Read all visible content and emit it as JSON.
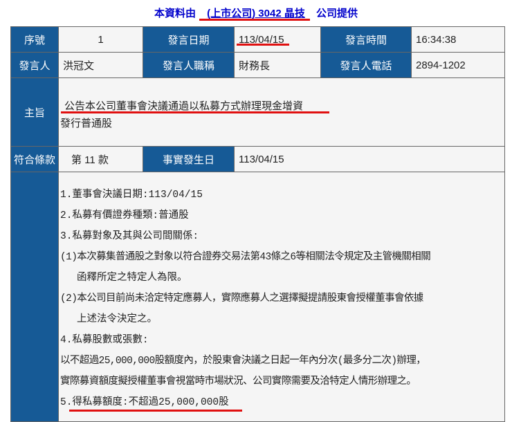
{
  "header": {
    "prefix": "本資料由",
    "company": "(上市公司) 3042 晶技",
    "suffix": "公司提供"
  },
  "row1": {
    "seq_label": "序號",
    "seq": "1",
    "date_label": "發言日期",
    "date": "113/04/15",
    "time_label": "發言時間",
    "time": "16:34:38"
  },
  "row2": {
    "speaker_label": "發言人",
    "speaker": "洪冠文",
    "title_label": "發言人職稱",
    "title": "財務長",
    "phone_label": "發言人電話",
    "phone": "2894-1202"
  },
  "subject": {
    "label": "主旨",
    "line1": "公告本公司董事會決議通過以私募方式辦理現金增資",
    "line2": "發行普通股"
  },
  "row4": {
    "clause_label": "符合條款",
    "clause": "第 11 款",
    "fact_date_label": "事實發生日",
    "fact_date": "113/04/15"
  },
  "body_lines": [
    "1.董事會決議日期:113/04/15",
    "2.私募有價證券種類:普通股",
    "3.私募對象及其與公司間關係:",
    "(1)本次募集普通股之對象以符合證券交易法第43條之6等相關法令規定及主管機關相關",
    "函釋所定之特定人為限。",
    "(2)本公司目前尚未洽定特定應募人，實際應募人之選擇擬提請股東會授權董事會依據",
    "上述法令決定之。",
    "4.私募股數或張數:",
    "以不超過25,000,000股額度內，於股東會決議之日起一年內分次(最多分二次)辦理，",
    "實際募資額度擬授權董事會視當時市場狀況、公司實際需要及洽特定人情形辦理之。",
    "5.得私募額度:不超過25,000,000股"
  ]
}
